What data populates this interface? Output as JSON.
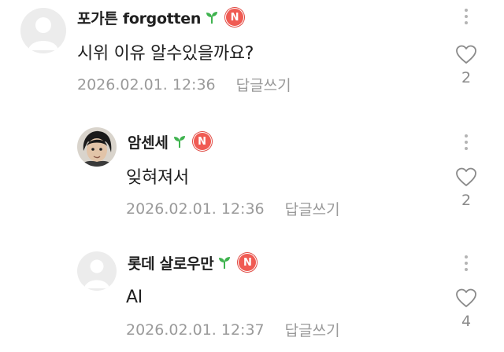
{
  "colors": {
    "badge": "#f05b53",
    "sprout": "#3fb34f",
    "meta_text": "#9a9a9a"
  },
  "comments": [
    {
      "author": "포가튼 forgotten",
      "avatar": "default-avatar",
      "badge_letter": "N",
      "text": "시위 이유 알수있을까요?",
      "timestamp": "2026.02.01. 12:36",
      "reply_label": "답글쓰기",
      "likes": "2",
      "is_reply": false
    },
    {
      "author": "암센세",
      "avatar": "photo-avatar",
      "badge_letter": "N",
      "text": "잊혀져서",
      "timestamp": "2026.02.01. 12:36",
      "reply_label": "답글쓰기",
      "likes": "2",
      "is_reply": true
    },
    {
      "author": "롯데 살로우만",
      "avatar": "default-avatar",
      "badge_letter": "N",
      "text": "AI",
      "timestamp": "2026.02.01. 12:37",
      "reply_label": "답글쓰기",
      "likes": "4",
      "is_reply": true
    }
  ]
}
